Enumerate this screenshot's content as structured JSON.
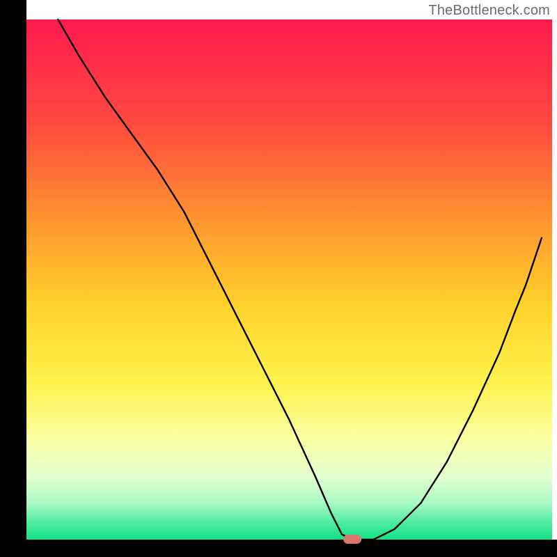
{
  "watermark": "TheBottleneck.com",
  "chart_data": {
    "type": "line",
    "title": "",
    "xlabel": "",
    "ylabel": "",
    "xlim": [
      0,
      100
    ],
    "ylim": [
      0,
      100
    ],
    "grid": false,
    "legend": false,
    "annotations": [],
    "marker": {
      "x": 62,
      "y": 0,
      "color": "#d9776b"
    },
    "x": [
      6,
      10,
      15,
      20,
      25,
      30,
      35,
      40,
      45,
      50,
      55,
      58,
      60,
      62,
      64,
      66,
      70,
      75,
      80,
      85,
      90,
      93,
      95,
      97,
      98
    ],
    "y": [
      100,
      93,
      85,
      78,
      71,
      63,
      53,
      43,
      33,
      23,
      12,
      5,
      1,
      0,
      0,
      0,
      2,
      7,
      15,
      25,
      36,
      44,
      49,
      55,
      58
    ],
    "background_gradient_stops": [
      {
        "offset": 0.0,
        "color": "#ff1a4e"
      },
      {
        "offset": 0.2,
        "color": "#ff4a3f"
      },
      {
        "offset": 0.4,
        "color": "#ff9a2e"
      },
      {
        "offset": 0.55,
        "color": "#ffd22b"
      },
      {
        "offset": 0.7,
        "color": "#fff24d"
      },
      {
        "offset": 0.8,
        "color": "#fbff9e"
      },
      {
        "offset": 0.88,
        "color": "#e2ffd0"
      },
      {
        "offset": 0.93,
        "color": "#a9f9c2"
      },
      {
        "offset": 0.97,
        "color": "#49eb9e"
      },
      {
        "offset": 1.0,
        "color": "#15e184"
      }
    ]
  }
}
